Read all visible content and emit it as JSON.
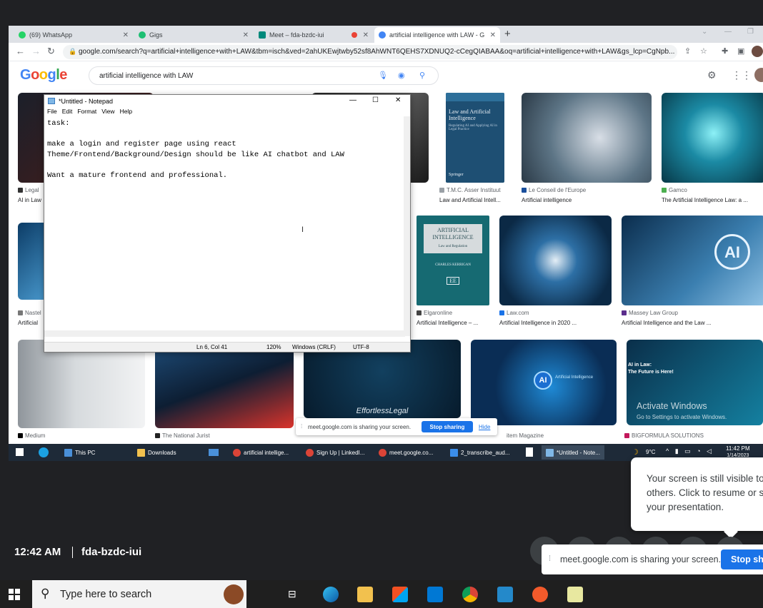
{
  "browser": {
    "tabs": [
      {
        "label": "(69) WhatsApp",
        "color": "#25d366"
      },
      {
        "label": "Gigs",
        "color": "#1dbf73"
      },
      {
        "label": "Meet – fda-bzdc-iui",
        "color": "#00897b"
      },
      {
        "label": "artificial intelligence with LAW - G",
        "color": "#4285f4"
      }
    ],
    "url": "google.com/search?q=artificial+intelligence+with+LAW&tbm=isch&ved=2ahUKEwjtwby52sf8AhWNT6QEHS7XDNUQ2-cCegQIABAA&oq=artificial+intelligence+with+LAW&gs_lcp=CgNpb..."
  },
  "google": {
    "logo": "Google",
    "query": "artificial intelligence with LAW"
  },
  "images": [
    {
      "source": "Legal",
      "title": "AI in Law"
    },
    {
      "source": "T.M.C. Asser Instituut",
      "title": "Law and Artificial Intell..."
    },
    {
      "source": "Le Conseil de l'Europe",
      "title": "Artificial intelligence"
    },
    {
      "source": "Gamco",
      "title": "The Artificial Intelligence Law: a ..."
    },
    {
      "source": "Nastel",
      "title": "Artificial"
    },
    {
      "source": "Elgaronline",
      "title": "Artificial Intelligence – ..."
    },
    {
      "source": "Law.com",
      "title": "Artificial Intelligence in 2020 ..."
    },
    {
      "source": "Massey Law Group",
      "title": "Artificial Intelligence and the Law ..."
    },
    {
      "source": "Medium",
      "title": ""
    },
    {
      "source": "The National Jurist",
      "title": ""
    },
    {
      "source": "item Magazine",
      "title": ""
    },
    {
      "source": "BIGFORMULA SOLUTIONS",
      "title": ""
    }
  ],
  "book_covers": {
    "law_ai": {
      "title": "Law and Artificial Intelligence",
      "subtitle": "Regulating AI and Applying AI in Legal Practice",
      "publisher": "Springer"
    },
    "ai_reg": {
      "title": "ARTIFICIAL INTELLIGENCE",
      "subtitle": "Law and Regulation",
      "editor": "CHARLES KERRIGAN",
      "mark": "EE"
    }
  },
  "image_overlays": {
    "effortless": "EffortlessLegal",
    "ai_badge": "AI",
    "ai_badge_sub": "Artificial Intelligence",
    "ai_law": "AI in Law:",
    "ai_future": "The Future is Here!",
    "activate_title": "Activate Windows",
    "activate_sub": "Go to Settings to activate Windows."
  },
  "notepad": {
    "title": "*Untitled - Notepad",
    "menu": [
      "File",
      "Edit",
      "Format",
      "View",
      "Help"
    ],
    "text": "task:\n\nmake a login and register page using react\nTheme/Frontend/Background/Design should be like AI chatbot and LAW\n\nWant a mature frontend and professional.",
    "status": {
      "position": "Ln 6, Col 41",
      "zoom": "120%",
      "line_endings": "Windows (CRLF)",
      "encoding": "UTF-8"
    }
  },
  "remote_sharebar": {
    "message": "meet.google.com is sharing your screen.",
    "stop": "Stop sharing",
    "hide": "Hide"
  },
  "remote_taskbar": {
    "items": [
      {
        "label": "This PC",
        "color": "#4a90d9"
      },
      {
        "label": "Downloads",
        "color": "#f2c14e"
      },
      {
        "label": "artificial intellige...",
        "color": "#db4437"
      },
      {
        "label": "Sign Up | LinkedI...",
        "color": "#db4437"
      },
      {
        "label": "meet.google.co...",
        "color": "#db4437"
      },
      {
        "label": "2_transcribe_aud...",
        "color": "#3b8eea"
      },
      {
        "label": "*Untitled - Note...",
        "color": "#7fb7e6"
      }
    ],
    "weather": "9°C",
    "time": "11:42 PM",
    "date": "1/14/2023"
  },
  "popup": {
    "message": "Your screen is still visible to others. Click to resume or stop your presentation."
  },
  "meeting": {
    "time": "12:42 AM",
    "code": "fda-bzdc-iui"
  },
  "local_sharebar": {
    "message": "meet.google.com is sharing your screen.",
    "stop": "Stop sharing"
  },
  "taskbar": {
    "search_placeholder": "Type here to search"
  },
  "colors": {
    "accent": "#1a73e8",
    "taskbar": "#1f1f1f",
    "background": "#202124"
  }
}
